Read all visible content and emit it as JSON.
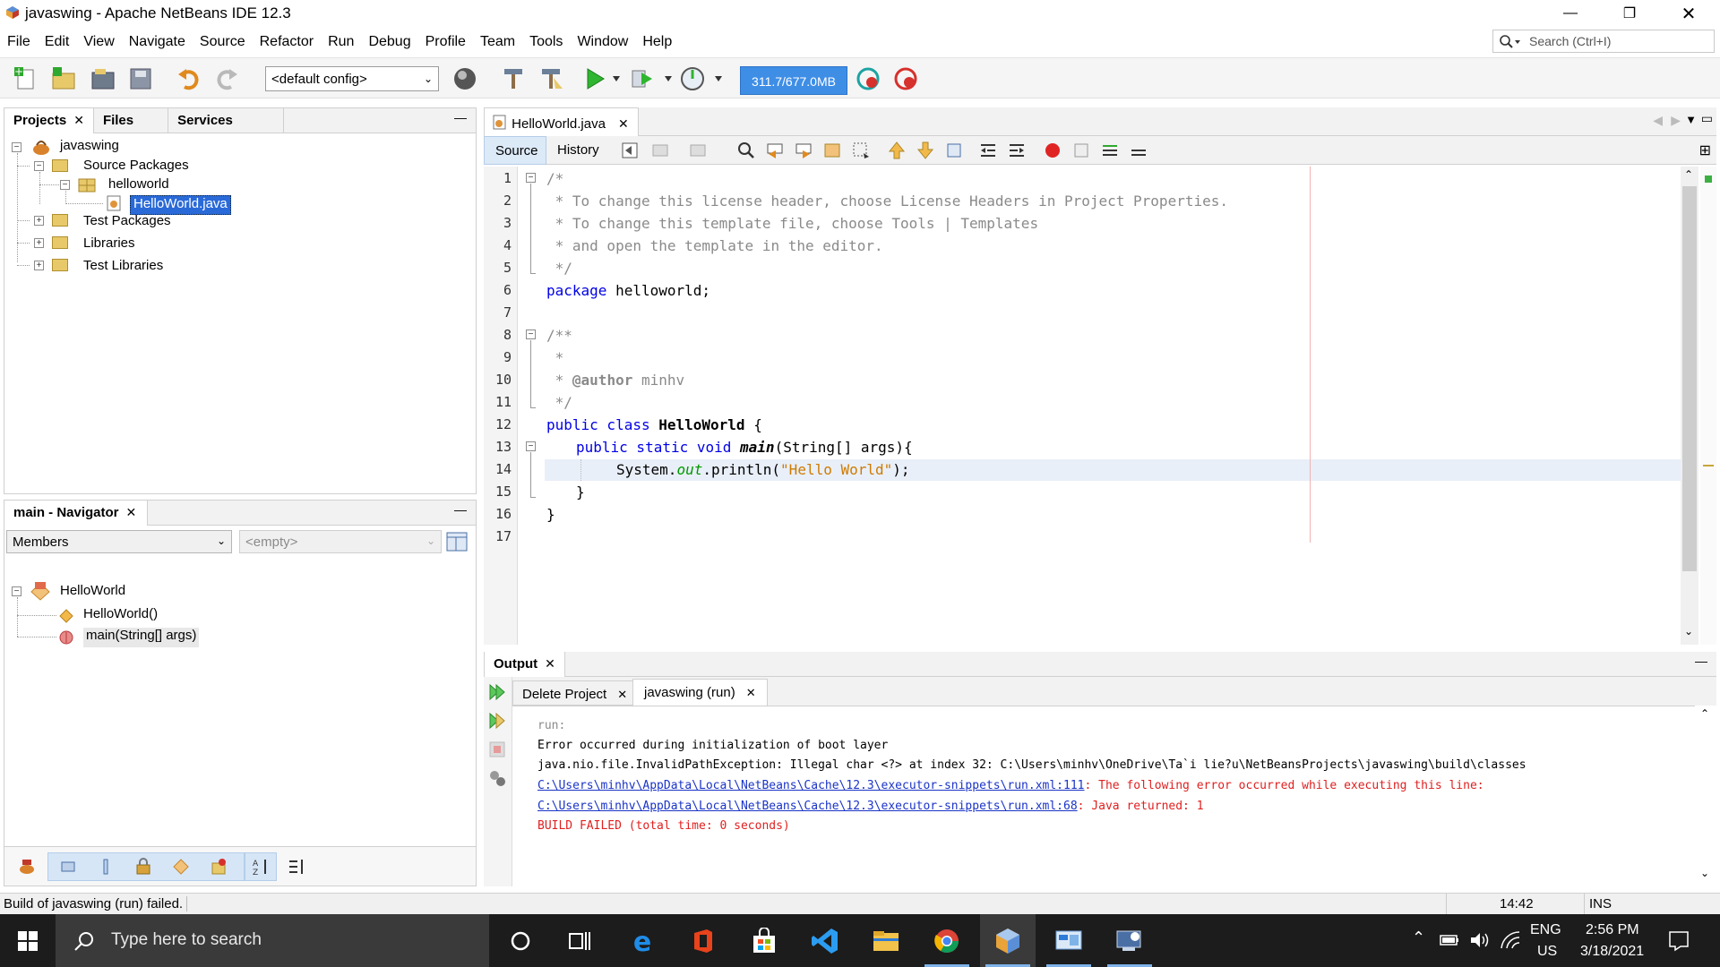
{
  "window": {
    "title": "javaswing - Apache NetBeans IDE 12.3"
  },
  "menu": [
    "File",
    "Edit",
    "View",
    "Navigate",
    "Source",
    "Refactor",
    "Run",
    "Debug",
    "Profile",
    "Team",
    "Tools",
    "Window",
    "Help"
  ],
  "search": {
    "placeholder": "Search (Ctrl+I)"
  },
  "toolbar": {
    "config": "<default config>",
    "memory": "311.7/677.0MB"
  },
  "projects_panel": {
    "tabs": [
      "Projects",
      "Files",
      "Services"
    ],
    "tree": {
      "project": "javaswing",
      "source_packages": "Source Packages",
      "package": "helloworld",
      "file": "HelloWorld.java",
      "test_packages": "Test Packages",
      "libraries": "Libraries",
      "test_libraries": "Test Libraries"
    }
  },
  "navigator": {
    "title": "main - Navigator",
    "members_select": "Members",
    "filter_select": "<empty>",
    "class": "HelloWorld",
    "constructor": "HelloWorld()",
    "method": "main(String[] args)"
  },
  "editor": {
    "tab": "HelloWorld.java",
    "source_tab": "Source",
    "history_tab": "History",
    "line_numbers": [
      "1",
      "2",
      "3",
      "4",
      "5",
      "6",
      "7",
      "8",
      "9",
      "10",
      "11",
      "12",
      "13",
      "14",
      "15",
      "16",
      "17"
    ],
    "code": {
      "l1": "/*",
      "l2": " * To change this license header, choose License Headers in Project Properties.",
      "l3": " * To change this template file, choose Tools | Templates",
      "l4": " * and open the template in the editor.",
      "l5": " */",
      "l6_kw": "package",
      "l6_rest": " helloworld;",
      "l8": "/**",
      "l9": " *",
      "l10_a": " * ",
      "l10_tag": "@author",
      "l10_b": " minhv",
      "l11": " */",
      "l12_kw": "public class ",
      "l12_name": "HelloWorld",
      "l12_rest": " {",
      "l13_kw": "public static void ",
      "l13_name": "main",
      "l13_rest": "(String[] args){",
      "l14_a": "System.",
      "l14_out": "out",
      "l14_b": ".println(",
      "l14_str": "\"Hello World\"",
      "l14_c": ");",
      "l15": "}",
      "l16": "}"
    }
  },
  "output": {
    "title": "Output",
    "tabs": [
      "Delete Project",
      "javaswing (run)"
    ],
    "lines": {
      "run": "run:",
      "err1": "Error occurred during initialization of boot layer",
      "err2": "java.nio.file.InvalidPathException: Illegal char <?> at index 32: C:\\Users\\minhv\\OneDrive\\Ta`i lie?u\\NetBeansProjects\\javaswing\\build\\classes",
      "link1": "C:\\Users\\minhv\\AppData\\Local\\NetBeans\\Cache\\12.3\\executor-snippets\\run.xml:111",
      "msg1": ": The following error occurred while executing this line:",
      "link2": "C:\\Users\\minhv\\AppData\\Local\\NetBeans\\Cache\\12.3\\executor-snippets\\run.xml:68",
      "msg2": ": Java returned: 1",
      "failed": "BUILD FAILED (total time: 0 seconds)"
    }
  },
  "status": {
    "message": "Build of javaswing (run) failed.",
    "position": "14:42",
    "mode": "INS"
  },
  "taskbar": {
    "search_placeholder": "Type here to search",
    "lang": "ENG",
    "region": "US",
    "time": "2:56 PM",
    "date": "3/18/2021"
  }
}
